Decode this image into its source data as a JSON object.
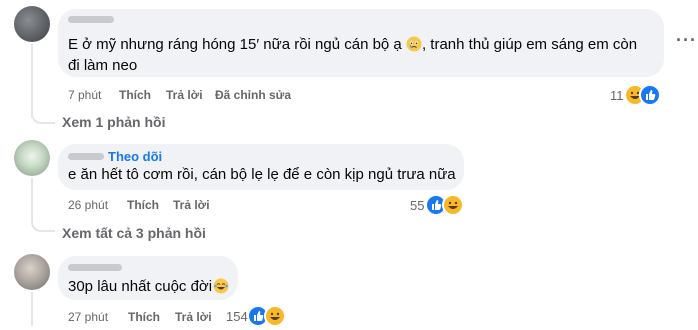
{
  "comments": [
    {
      "text_line1": "E ở mỹ nhưng ráng hóng 15′ nữa rồi ngủ cán bộ ạ",
      "text_line2": "tranh thủ giúp em sáng em còn",
      "text_line3": "đi làm neo",
      "emoji_inline": "crying-face-emoji",
      "time": "7 phút",
      "like": "Thích",
      "reply": "Trả lời",
      "edited": "Đã chỉnh sửa",
      "reaction_count": "11",
      "reactions": [
        "haha",
        "like"
      ]
    },
    {
      "follow": "Theo dõi",
      "text_line1": "e ăn hết tô cơm rồi, cán bộ lẹ lẹ để e còn kịp ngủ trưa nữa",
      "time": "26 phút",
      "like": "Thích",
      "reply": "Trả lời",
      "reaction_count": "55",
      "reactions": [
        "like",
        "haha"
      ]
    },
    {
      "text_line1": "30p lâu nhất cuộc đời",
      "emoji_inline": "laughing-tears-emoji",
      "time": "27 phút",
      "like": "Thích",
      "reply": "Trả lời",
      "reaction_count": "154",
      "reactions": [
        "like",
        "haha"
      ]
    }
  ],
  "view_replies": [
    "Xem 1 phản hồi",
    "Xem tất cả 3 phản hồi"
  ],
  "colors": {
    "like_blue": "#1877f2",
    "haha_yellow": "#f7b928",
    "bubble_bg": "#f0f2f5",
    "meta_gray": "#65676b"
  },
  "icons": {
    "more": "more-options-icon"
  }
}
